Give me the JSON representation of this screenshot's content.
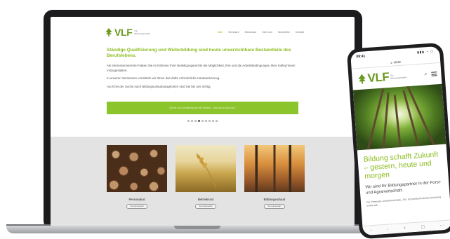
{
  "desktop": {
    "logo": {
      "name": "VLF",
      "tagline": "Die Bildungsgestalter"
    },
    "nav": [
      {
        "label": "Start",
        "active": true
      },
      {
        "label": "Seminare",
        "active": false
      },
      {
        "label": "Messebau",
        "active": false
      },
      {
        "label": "Über uns",
        "active": false
      },
      {
        "label": "Newsletter",
        "active": false
      },
      {
        "label": "Kontakt",
        "active": false
      }
    ],
    "intro": {
      "heading": "Ständige Qualifizierung und Weiterbildung sind heute unverzichtbare Bestandteile des Berufslebens.",
      "paragraphs": [
        "Als Interessenvertreter haben Sie im Rahmen Ihrer Beteiligungsrechte die Möglichkeit, Ihre und die Arbeitsbedingungen Ihrer Kolleg*innen mitzugestalten.",
        "In unseren Seminaren vermitteln wir Ihnen das dafür erforderliche Handwerkszeug.",
        "Auch bei der Suche nach Bildungsurlaubsangeboten sind Sie bei uns richtig."
      ]
    },
    "quote": "„Nichts ist so beständig wie der Wandel – und das ist auch gut.“",
    "slider_dots": 9,
    "slider_active_index": 3,
    "cards": [
      {
        "title": "Personalrat",
        "button": "Seminarauswahl",
        "image": "wood-logs"
      },
      {
        "title": "Betriebsrat",
        "button": "Seminarauswahl",
        "image": "wheat-field"
      },
      {
        "title": "Bildungsurlaub",
        "button": "Seminarauswahl",
        "image": "autumn-forest"
      }
    ]
  },
  "mobile": {
    "status_time": "09:41",
    "status_icons": "▮▮▮ ◔ ▭",
    "url": "vlf.de",
    "logo": {
      "name": "VLF",
      "tagline": "Die Bildungsgestalter"
    },
    "hero_image": "forest-canopy",
    "heading": "Bildung schafft Zukunft – gestern, heute und morgen",
    "text": "Wir sind Ihr Bildungspartner in der Forst- und Agrarwirtschaft.",
    "small_text": "Für Personal- und Betriebsräte, JAV, Schwerbehindertenvertretung sowie auf ...",
    "toolbar": [
      "‹",
      "›",
      "+",
      "▢",
      "⋯"
    ]
  },
  "colors": {
    "brand_green": "#8bbd1f",
    "logo_green": "#6a9a1f",
    "quote_bar": "#8bc42b",
    "card_section": "#e3e3e3",
    "device_frame": "#1c1c1e"
  }
}
